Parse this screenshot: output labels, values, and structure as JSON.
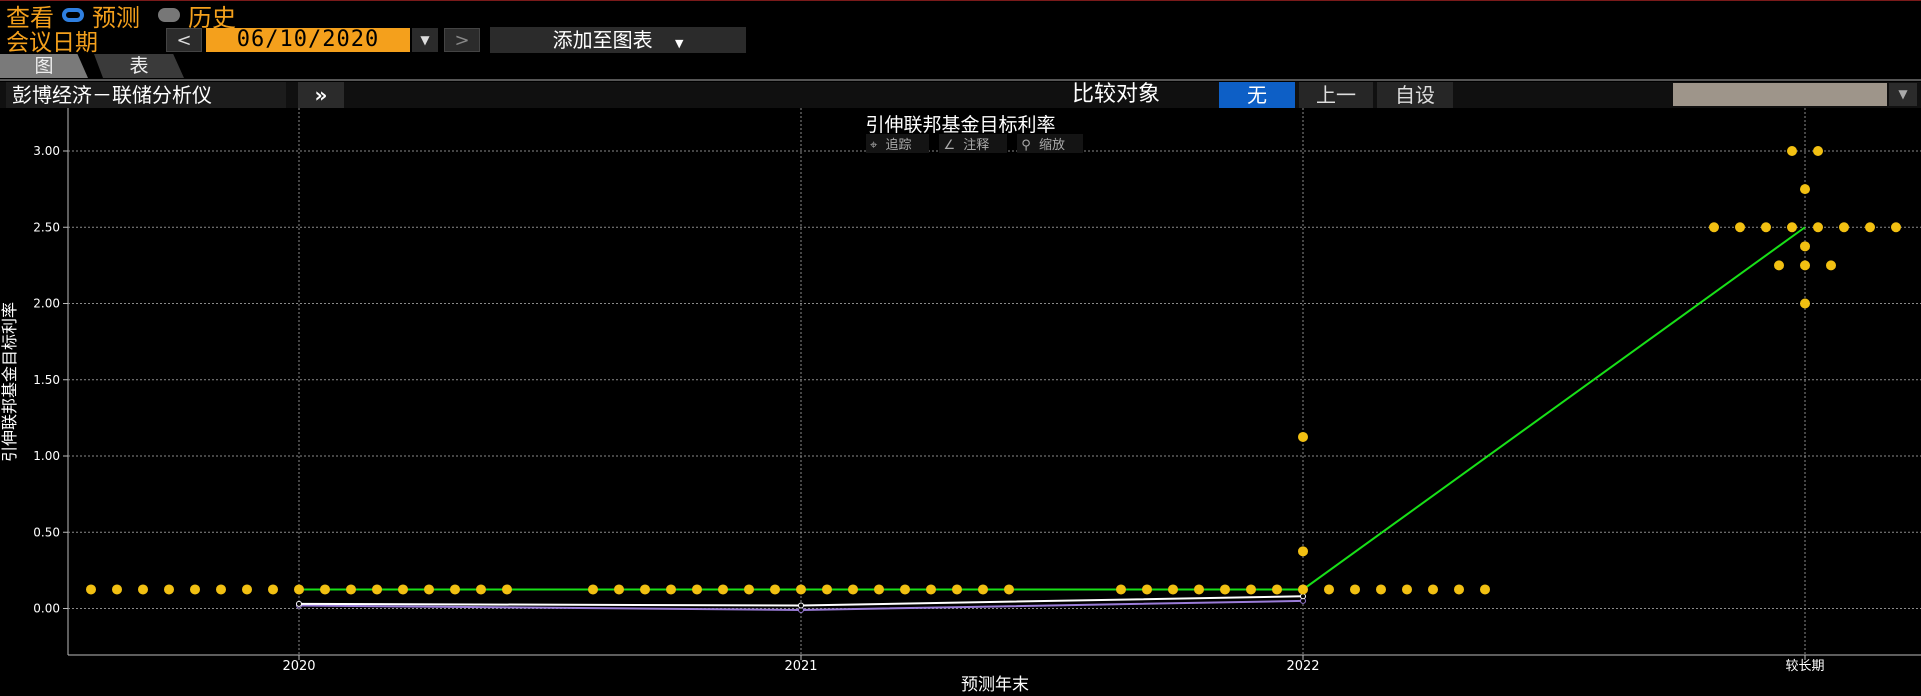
{
  "header": {
    "view_label": "查看",
    "forecast_label": "预测",
    "history_label": "历史",
    "meeting_date_label": "会议日期",
    "prev_label": "<",
    "date_value": "06/10/2020",
    "dropdown_glyph": "▼",
    "next_label": ">",
    "add_to_chart_label": "添加至图表",
    "add_dropdown_glyph": "▼"
  },
  "tabs": [
    "图",
    "表"
  ],
  "toolbar": {
    "app_title": "彭博经济－联储分析仪",
    "expand_label": "»",
    "compare_label": "比较对象",
    "compare_options": [
      "无",
      "上一",
      "自设"
    ],
    "compare_selected": "无"
  },
  "chart_tools": [
    "追踪",
    "注释",
    "缩放"
  ],
  "colors": {
    "accent_orange": "#f4a01c",
    "selected_blue": "#0d5fc6",
    "dots": "#f2c012",
    "median_line": "#18e018",
    "market_line_1": "#ffffff",
    "market_line_2": "#9a7cd8"
  },
  "chart_data": {
    "type": "scatter",
    "title": "引伸联邦基金目标利率",
    "xlabel": "预测年末",
    "ylabel": "引伸联邦基金目标利率",
    "categories": [
      "2020",
      "2021",
      "2022",
      "较长期"
    ],
    "ylim": [
      -0.25,
      3.3
    ],
    "yticks": [
      0.0,
      0.5,
      1.0,
      1.5,
      2.0,
      2.5,
      3.0
    ],
    "ytick_labels": [
      "0.00",
      "0.50",
      "1.00",
      "1.50",
      "2.00",
      "2.50",
      "3.00"
    ],
    "grid": true,
    "dot_plot": [
      {
        "category": "2020",
        "points": [
          {
            "rate": 0.125,
            "count": 17
          }
        ]
      },
      {
        "category": "2021",
        "points": [
          {
            "rate": 0.125,
            "count": 17
          }
        ]
      },
      {
        "category": "2022",
        "points": [
          {
            "rate": 0.125,
            "count": 15
          },
          {
            "rate": 0.375,
            "count": 1
          },
          {
            "rate": 1.125,
            "count": 1
          }
        ]
      },
      {
        "category": "较长期",
        "points": [
          {
            "rate": 2.0,
            "count": 1
          },
          {
            "rate": 2.25,
            "count": 3
          },
          {
            "rate": 2.375,
            "count": 1
          },
          {
            "rate": 2.5,
            "count": 8
          },
          {
            "rate": 2.75,
            "count": 1
          },
          {
            "rate": 3.0,
            "count": 2
          }
        ]
      }
    ],
    "series": [
      {
        "x": [
          "2020",
          "2021",
          "2022",
          "较长期"
        ],
        "values": [
          0.125,
          0.125,
          0.125,
          2.5
        ],
        "style": "green"
      },
      {
        "x": [
          "2020",
          "2021",
          "2022"
        ],
        "values": [
          0.03,
          0.02,
          0.08
        ],
        "style": "white"
      },
      {
        "x": [
          "2020",
          "2021",
          "2022"
        ],
        "values": [
          0.02,
          -0.01,
          0.05
        ],
        "style": "purple"
      }
    ]
  }
}
